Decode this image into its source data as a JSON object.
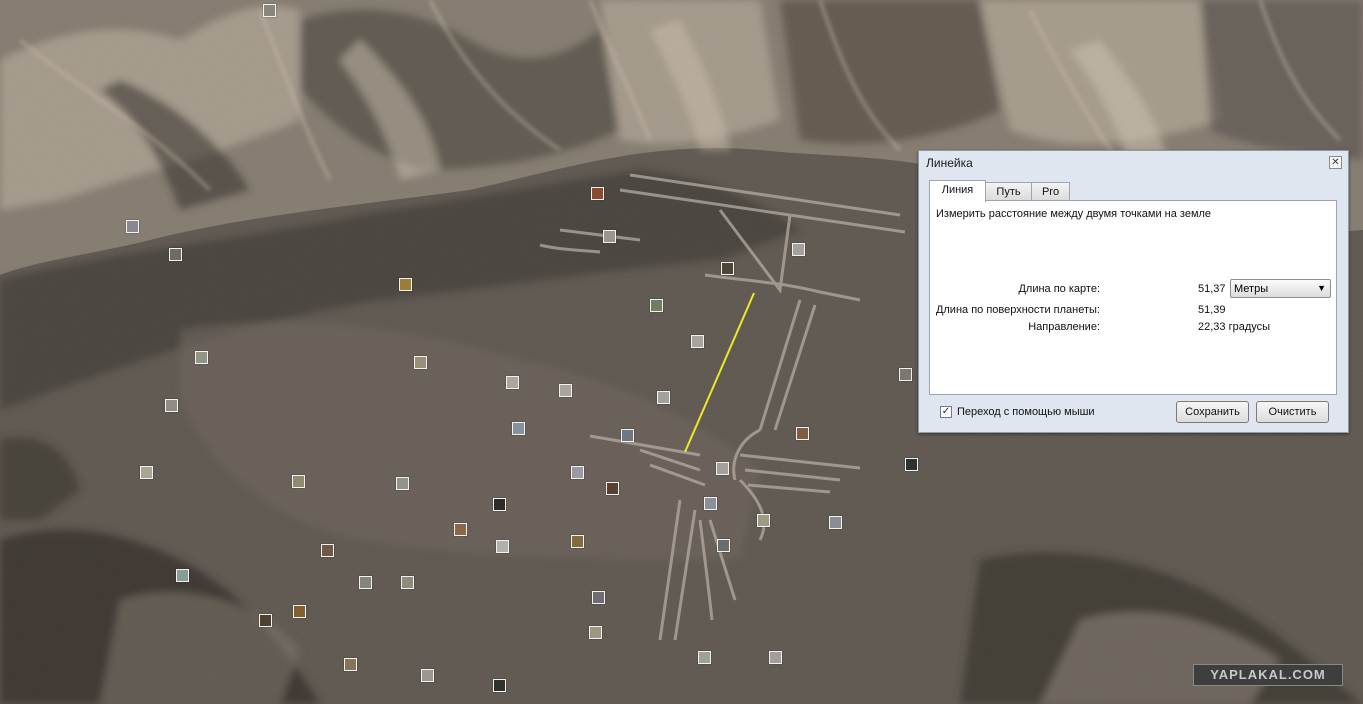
{
  "ruler": {
    "title": "Линейка",
    "close_icon": "close-icon",
    "tabs": [
      "Линия",
      "Путь",
      "Pro"
    ],
    "active_tab": "Линия",
    "description": "Измерить расстояние между двумя точками на земле",
    "map_length_label": "Длина по карте:",
    "map_length_value": "51,37",
    "units_selected": "Метры",
    "ground_length_label": "Длина по поверхности планеты:",
    "ground_length_value": "51,39",
    "heading_label": "Направление:",
    "heading_value": "22,33 градусы",
    "mouse_nav_label": "Переход с помощью мыши",
    "mouse_nav_checked": true,
    "save_label": "Сохранить",
    "clear_label": "Очистить"
  },
  "map": {
    "measure_line_color": "#ffff00",
    "photo_icon": "photo-thumbnail-icon",
    "photo_count": 52
  },
  "watermark": "YAPLAKAL.COM"
}
